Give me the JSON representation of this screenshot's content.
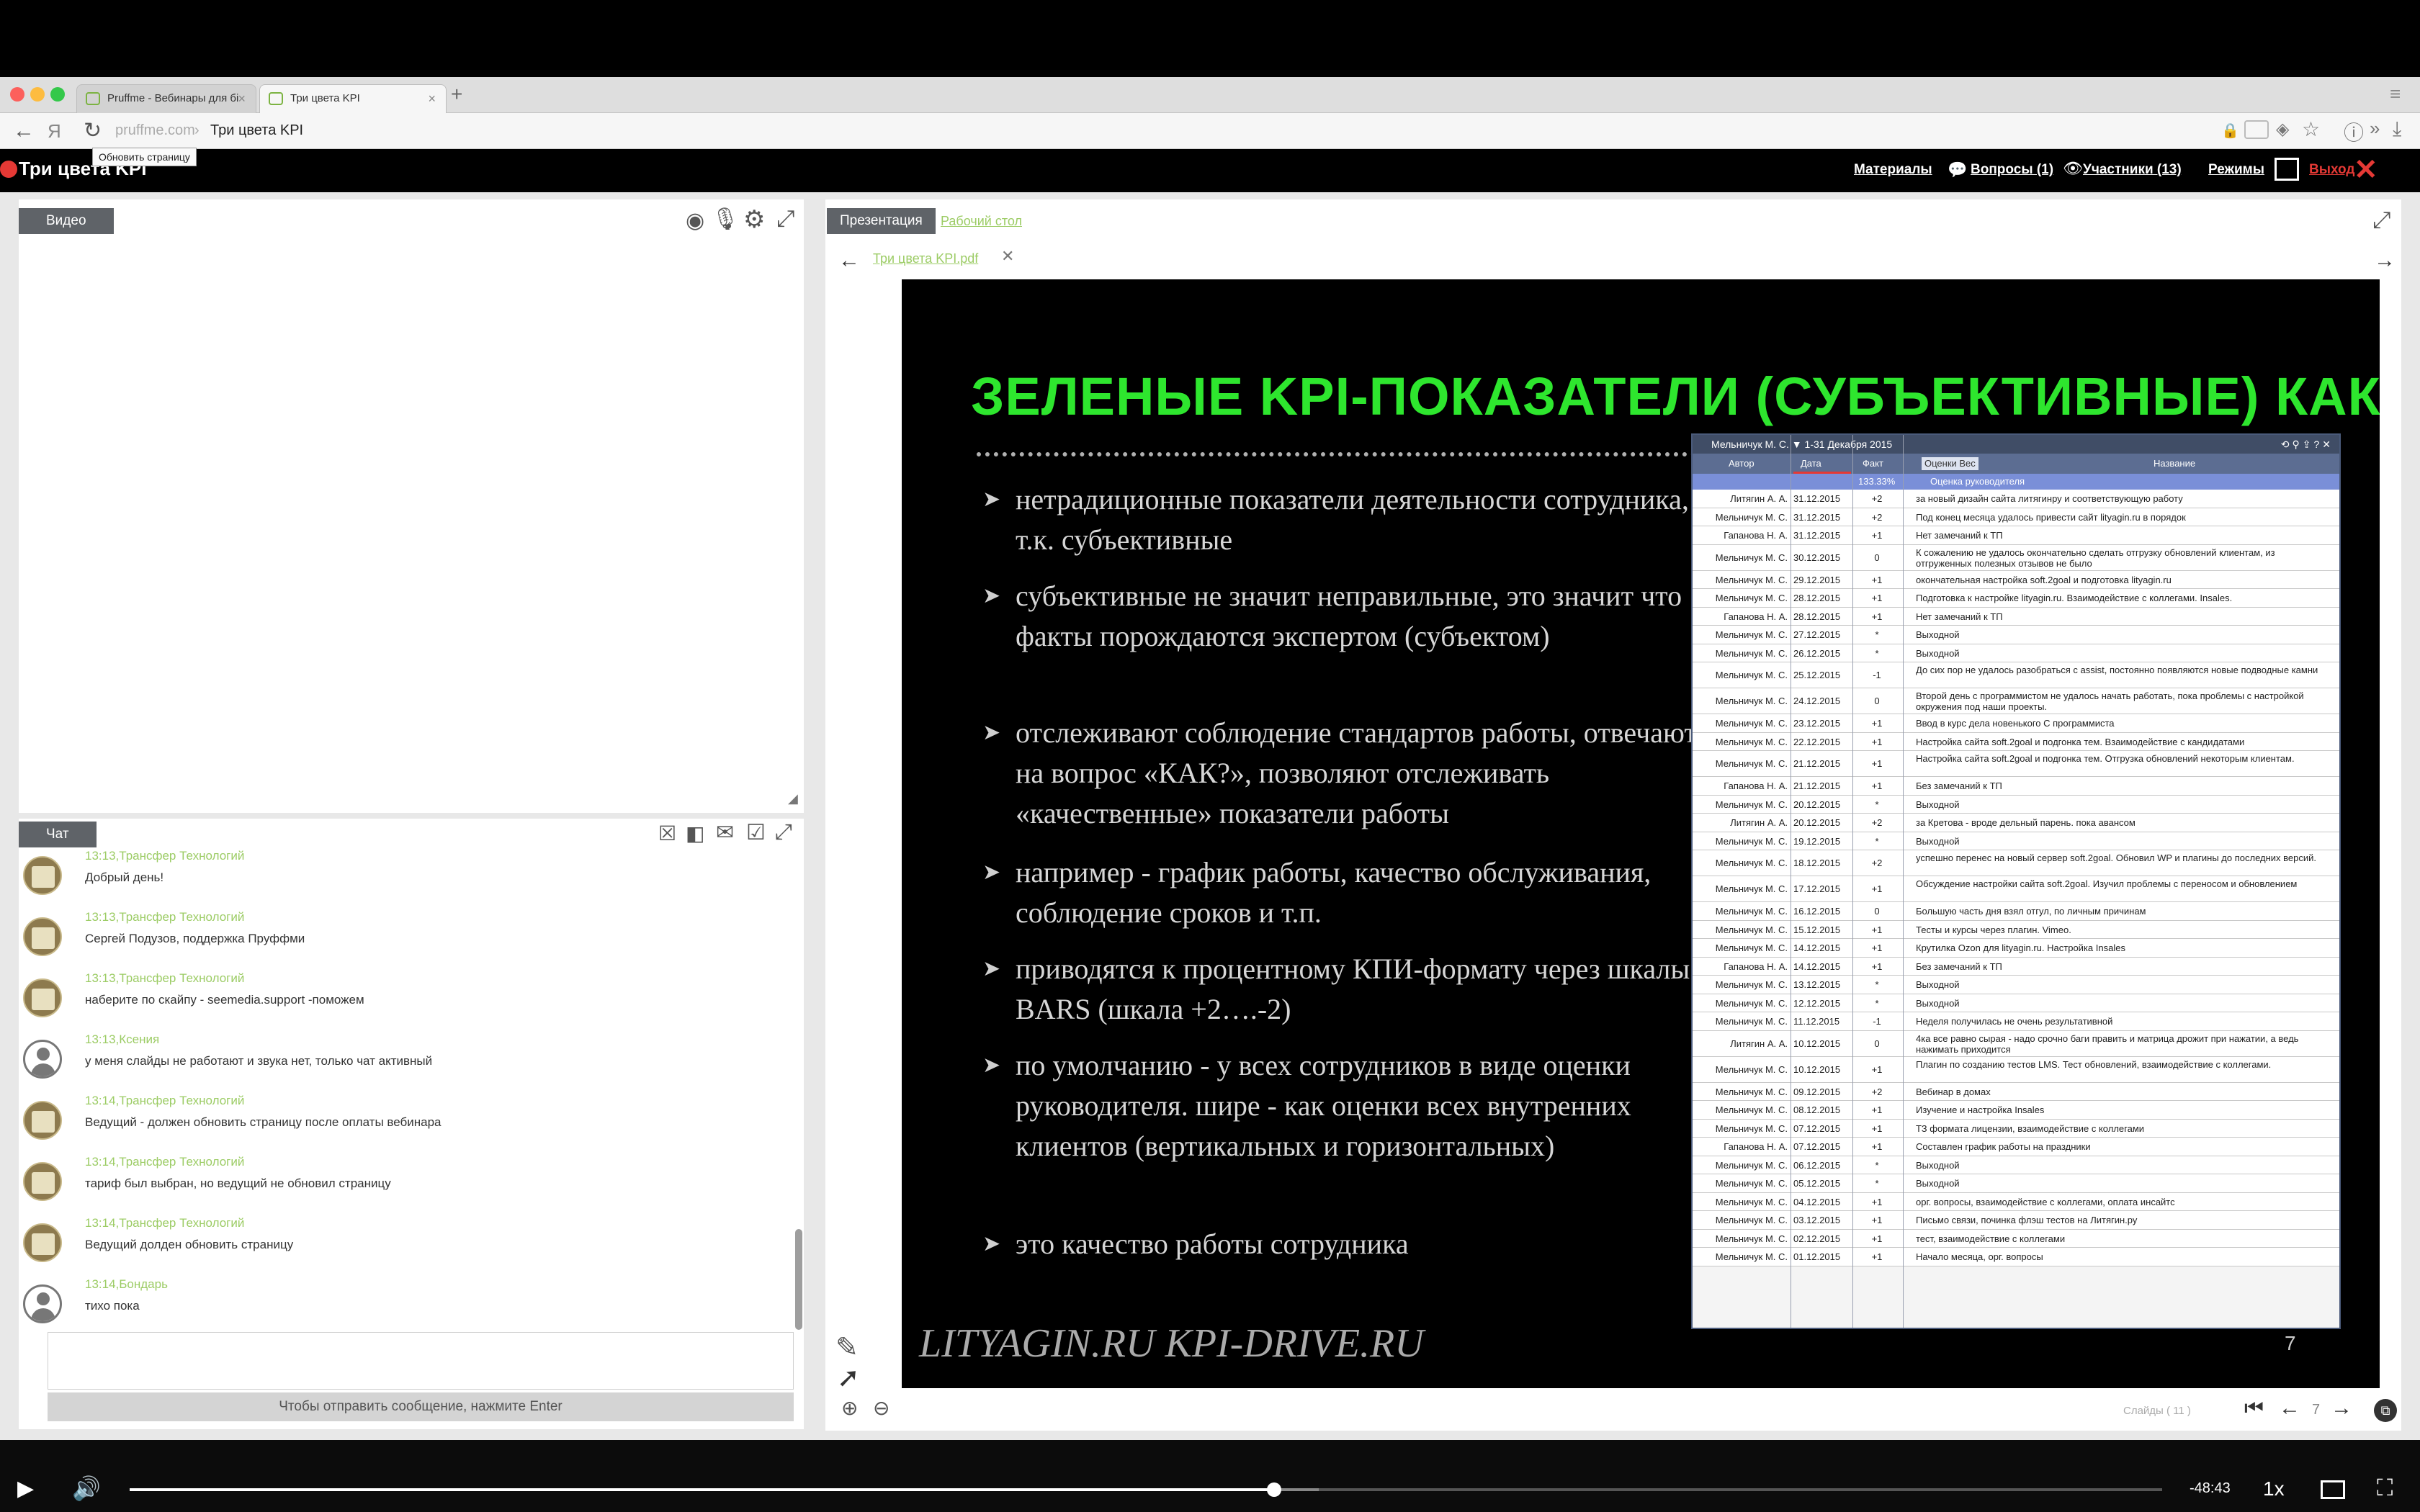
{
  "browser": {
    "tabs": [
      {
        "label": "Pruffme - Вебинары для бі"
      },
      {
        "label": "Три цвета KPI"
      }
    ],
    "url_host": "pruffme.com",
    "url_title": "Три цвета KPI",
    "tooltip": "Обновить страницу"
  },
  "app": {
    "title": "Три цвета KPI",
    "links": {
      "materials": "Материалы",
      "questions": "Вопросы (1)",
      "participants": "Участники (13)",
      "modes": "Режимы",
      "exit": "Выход"
    }
  },
  "video_panel": {
    "tab": "Видео"
  },
  "chat": {
    "tab": "Чат",
    "messages": [
      {
        "time": "13:13,",
        "author": "Трансфер Технологий",
        "text": "Добрый день!",
        "avatar": "company"
      },
      {
        "time": "13:13,",
        "author": "Трансфер Технологий",
        "text": "Сергей Подузов, поддержка Пруффми",
        "avatar": "company"
      },
      {
        "time": "13:13,",
        "author": "Трансфер Технологий",
        "text": "наберите по скайпу - seemedia.support -поможем",
        "avatar": "company"
      },
      {
        "time": "13:13,",
        "author": "Ксения",
        "text": "у меня слайды не работают и звука нет, только чат активный",
        "avatar": "user"
      },
      {
        "time": "13:14,",
        "author": "Трансфер Технологий",
        "text": "Ведущий - должен обновить страницу после оплаты вебинара",
        "avatar": "company"
      },
      {
        "time": "13:14,",
        "author": "Трансфер Технологий",
        "text": "тариф был выбран, но ведущий не обновил страницу",
        "avatar": "company"
      },
      {
        "time": "13:14,",
        "author": "Трансфер Технологий",
        "text": "Ведущий долден обновить страницу",
        "avatar": "company"
      },
      {
        "time": "13:14,",
        "author": "Бондарь",
        "text": "тихо пока",
        "avatar": "user"
      }
    ],
    "send_hint": "Чтобы отправить сообщение, нажмите Enter"
  },
  "presentation": {
    "tab_active": "Презентация",
    "tab_other": "Рабочий стол",
    "file_name": "Три цвета KPI.pdf",
    "slides_label": "Слайды (  11  )",
    "current_slide": "7",
    "slide": {
      "title": "ЗЕЛЕНЫЕ KPI-ПОКАЗАТЕЛИ (СУБЪЕКТИВНЫЕ) КАК?",
      "bullets": [
        "нетрадиционные показатели деятельности сотрудника, т.к. субъективные",
        "субъективные не значит неправильные, это значит что факты порождаются экспертом (субъектом)",
        "отслеживают соблюдение стандартов работы, отвечают на вопрос «КАК?», позволяют отслеживать «качественные» показатели работы",
        "например - график работы, качество обслуживания, соблюдение сроков и т.п.",
        "приводятся к процентному КПИ-формату через шкалы BARS (шкала +2….-2)",
        "по умолчанию - у всех сотрудников в виде оценки руководителя. шире - как оценки всех внутренних клиентов (вертикальных и горизонтальных)",
        "это качество работы сотрудника"
      ],
      "footer": "LITYAGIN.RU  KPI-DRIVE.RU",
      "page_number": "7",
      "kpi_table": {
        "title": "Мельничук М. С.  ▼  1-31 Декабря 2015",
        "headers": {
          "author": "Автор",
          "date": "Дата",
          "fact": "Факт",
          "tags": "Оценки  Вес",
          "name": "Название"
        },
        "group_percent": "133.33%",
        "group_label": "Оценка руководителя",
        "rows": [
          {
            "a": "Литягин А. А.",
            "d": "31.12.2015",
            "f": "+2",
            "t": "за новый дизайн сайта литягинру и соответствующую работу"
          },
          {
            "a": "Мельничук М. С.",
            "d": "31.12.2015",
            "f": "+2",
            "t": "Под конец месяца удалось привести сайт lityagin.ru в порядок"
          },
          {
            "a": "Гапанова Н. А.",
            "d": "31.12.2015",
            "f": "+1",
            "t": "Нет замечаний к ТП"
          },
          {
            "a": "Мельничук М. С.",
            "d": "30.12.2015",
            "f": "0",
            "t": "К сожалению не удалось окончательно сделать отгрузку обновлений клиентам, из отгруженных полезных отзывов не было",
            "tall": true
          },
          {
            "a": "Мельничук М. С.",
            "d": "29.12.2015",
            "f": "+1",
            "t": "окончательная настройка soft.2goal и подготовка lityagin.ru"
          },
          {
            "a": "Мельничук М. С.",
            "d": "28.12.2015",
            "f": "+1",
            "t": "Подготовка к настройке lityagin.ru. Взаимодействие с коллегами. Insales."
          },
          {
            "a": "Гапанова Н. А.",
            "d": "28.12.2015",
            "f": "+1",
            "t": "Нет замечаний к ТП"
          },
          {
            "a": "Мельничук М. С.",
            "d": "27.12.2015",
            "f": "*",
            "t": "Выходной"
          },
          {
            "a": "Мельничук М. С.",
            "d": "26.12.2015",
            "f": "*",
            "t": "Выходной"
          },
          {
            "a": "Мельничук М. С.",
            "d": "25.12.2015",
            "f": "-1",
            "t": "До сих пор не удалось разобраться с assist, постоянно появляются новые подводные камни",
            "tall": true
          },
          {
            "a": "Мельничук М. С.",
            "d": "24.12.2015",
            "f": "0",
            "t": "Второй день с программистом не удалось начать работать, пока проблемы с настройкой окружения под наши проекты.",
            "tall": true
          },
          {
            "a": "Мельничук М. С.",
            "d": "23.12.2015",
            "f": "+1",
            "t": "Ввод в курс дела новенького С программиста"
          },
          {
            "a": "Мельничук М. С.",
            "d": "22.12.2015",
            "f": "+1",
            "t": "Настройка сайта soft.2goal и подгонка тем. Взаимодействие с кандидатами"
          },
          {
            "a": "Мельничук М. С.",
            "d": "21.12.2015",
            "f": "+1",
            "t": "Настройка сайта soft.2goal и подгонка тем. Отгрузка обновлений некоторым клиентам.",
            "tall": true
          },
          {
            "a": "Гапанова Н. А.",
            "d": "21.12.2015",
            "f": "+1",
            "t": "Без замечаний к ТП"
          },
          {
            "a": "Мельничук М. С.",
            "d": "20.12.2015",
            "f": "*",
            "t": "Выходной"
          },
          {
            "a": "Литягин А. А.",
            "d": "20.12.2015",
            "f": "+2",
            "t": "за Кретова - вроде дельный парень. пока авансом"
          },
          {
            "a": "Мельничук М. С.",
            "d": "19.12.2015",
            "f": "*",
            "t": "Выходной"
          },
          {
            "a": "Мельничук М. С.",
            "d": "18.12.2015",
            "f": "+2",
            "t": "успешно перенес на новый сервер soft.2goal. Обновил WP и плагины до последних версий.",
            "tall": true
          },
          {
            "a": "Мельничук М. С.",
            "d": "17.12.2015",
            "f": "+1",
            "t": "Обсуждение настройки сайта soft.2goal. Изучил проблемы с переносом и обновлением",
            "tall": true
          },
          {
            "a": "Мельничук М. С.",
            "d": "16.12.2015",
            "f": "0",
            "t": "Большую часть дня взял отгул, по личным причинам"
          },
          {
            "a": "Мельничук М. С.",
            "d": "15.12.2015",
            "f": "+1",
            "t": "Тесты и курсы через плагин. Vimeo."
          },
          {
            "a": "Мельничук М. С.",
            "d": "14.12.2015",
            "f": "+1",
            "t": "Крутилка Ozon для lityagin.ru. Настройка Insales"
          },
          {
            "a": "Гапанова Н. А.",
            "d": "14.12.2015",
            "f": "+1",
            "t": "Без замечаний к ТП"
          },
          {
            "a": "Мельничук М. С.",
            "d": "13.12.2015",
            "f": "*",
            "t": "Выходной"
          },
          {
            "a": "Мельничук М. С.",
            "d": "12.12.2015",
            "f": "*",
            "t": "Выходной"
          },
          {
            "a": "Мельничук М. С.",
            "d": "11.12.2015",
            "f": "-1",
            "t": "Неделя получилась не очень результативной"
          },
          {
            "a": "Литягин А. А.",
            "d": "10.12.2015",
            "f": "0",
            "t": "4ка все равно сырая - надо срочно баги править и матрица дрожит при нажатии, а ведь нажимать приходится",
            "tall": true
          },
          {
            "a": "Мельничук М. С.",
            "d": "10.12.2015",
            "f": "+1",
            "t": "Плагин по созданию тестов LMS. Тест обновлений, взаимодействие с коллегами.",
            "tall": true
          },
          {
            "a": "Мельничук М. С.",
            "d": "09.12.2015",
            "f": "+2",
            "t": "Вебинар в домах"
          },
          {
            "a": "Мельничук М. С.",
            "d": "08.12.2015",
            "f": "+1",
            "t": "Изучение и настройка Insales"
          },
          {
            "a": "Мельничук М. С.",
            "d": "07.12.2015",
            "f": "+1",
            "t": "ТЗ формата лицензии, взаимодействие с коллегами"
          },
          {
            "a": "Гапанова Н. А.",
            "d": "07.12.2015",
            "f": "+1",
            "t": "Составлен график работы на праздники"
          },
          {
            "a": "Мельничук М. С.",
            "d": "06.12.2015",
            "f": "*",
            "t": "Выходной"
          },
          {
            "a": "Мельничук М. С.",
            "d": "05.12.2015",
            "f": "*",
            "t": "Выходной"
          },
          {
            "a": "Мельничук М. С.",
            "d": "04.12.2015",
            "f": "+1",
            "t": "орг. вопросы, взаимодействие с коллегами, оплата инсайтс"
          },
          {
            "a": "Мельничук М. С.",
            "d": "03.12.2015",
            "f": "+1",
            "t": "Письмо связи, починка флэш тестов на Литягин.ру"
          },
          {
            "a": "Мельничук М. С.",
            "d": "02.12.2015",
            "f": "+1",
            "t": "тест, взаимодействие с коллегами"
          },
          {
            "a": "Мельничук М. С.",
            "d": "01.12.2015",
            "f": "+1",
            "t": "Начало месяца, орг. вопросы"
          }
        ]
      }
    }
  },
  "video_controls": {
    "time_remaining": "-48:43",
    "speed": "1x",
    "progress": 0.563,
    "buffered": 0.585
  }
}
